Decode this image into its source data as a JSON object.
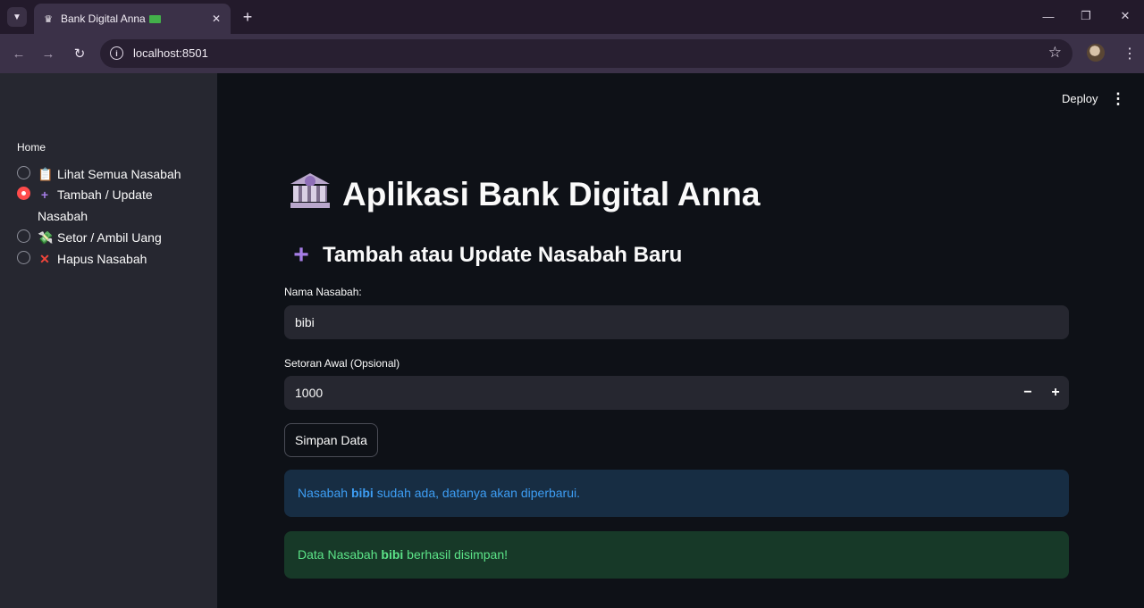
{
  "browser": {
    "tab_title": "Bank Digital Anna",
    "url": "localhost:8501"
  },
  "app": {
    "deploy_label": "Deploy",
    "sidebar": {
      "heading": "Home",
      "items": [
        {
          "icon": "clipboard-icon",
          "label": "Lihat Semua Nasabah",
          "selected": false
        },
        {
          "icon": "plus-icon",
          "label": "Tambah / Update Nasabah",
          "selected": true
        },
        {
          "icon": "money-with-wings-icon",
          "label": "Setor / Ambil Uang",
          "selected": false
        },
        {
          "icon": "cross-mark-icon",
          "label": "Hapus Nasabah",
          "selected": false
        }
      ]
    },
    "title": "Aplikasi Bank Digital Anna",
    "subtitle": "Tambah atau Update Nasabah Baru",
    "form": {
      "name_label": "Nama Nasabah:",
      "name_value": "bibi",
      "deposit_label": "Setoran Awal (Opsional)",
      "deposit_value": "1000",
      "submit_label": "Simpan Data"
    },
    "info_alert": {
      "before": "Nasabah ",
      "name": "bibi",
      "after": " sudah ada, datanya akan diperbarui."
    },
    "success_alert": {
      "before": "Data Nasabah ",
      "name": "bibi",
      "after": " berhasil disimpan!"
    }
  },
  "colors": {
    "accent": "#ff4b4b",
    "info": "#3d9df3",
    "success": "#5ce488"
  }
}
